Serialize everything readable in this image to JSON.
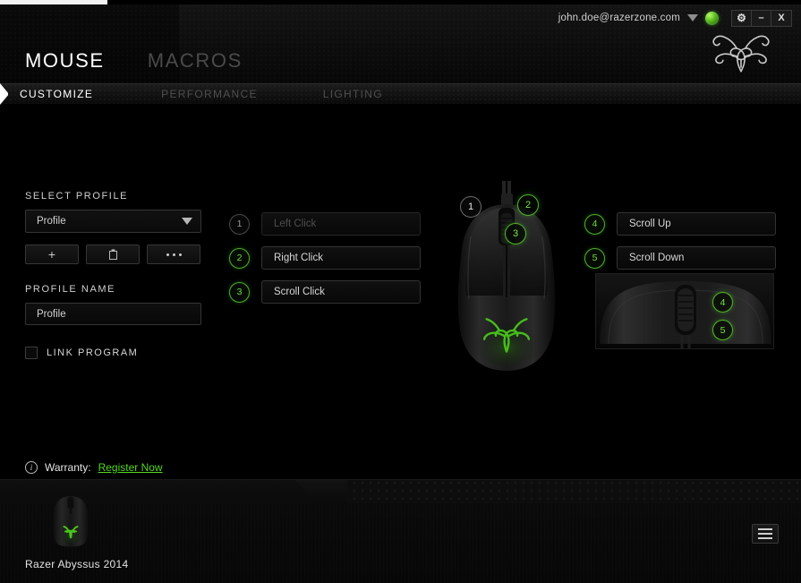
{
  "titlebar": {
    "user_email": "john.doe@razerzone.com",
    "dropdown_icon": "caret-down-icon",
    "status_icon": "green-status-orb",
    "buttons": [
      {
        "name": "settings",
        "icon": "gear-icon",
        "glyph": "⚙"
      },
      {
        "name": "minimize",
        "icon": "minimize-icon",
        "glyph": "–"
      },
      {
        "name": "close",
        "icon": "close-icon",
        "glyph": "X"
      }
    ]
  },
  "header": {
    "device_tabs": [
      {
        "label": "MOUSE",
        "active": true
      },
      {
        "label": "MACROS",
        "active": false
      }
    ],
    "logo_icon": "razer-triple-snake-logo"
  },
  "subtabs": [
    {
      "label": "CUSTOMIZE",
      "active": true
    },
    {
      "label": "PERFORMANCE",
      "active": false
    },
    {
      "label": "LIGHTING",
      "active": false
    }
  ],
  "profile": {
    "select_label": "SELECT PROFILE",
    "selected_profile": "Profile",
    "buttons": [
      {
        "name": "add-profile",
        "icon": "plus-icon",
        "glyph": "+"
      },
      {
        "name": "delete-profile",
        "icon": "trash-icon",
        "glyph": ""
      },
      {
        "name": "more-options",
        "icon": "ellipsis-icon",
        "glyph": ""
      }
    ],
    "name_label": "PROFILE NAME",
    "name_value": "Profile",
    "name_placeholder": "Profile",
    "link_program_label": "LINK PROGRAM",
    "link_program_checked": false
  },
  "assignments_left": [
    {
      "number": "1",
      "label": "Left Click",
      "state": "disabled"
    },
    {
      "number": "2",
      "label": "Right Click",
      "state": "active"
    },
    {
      "number": "3",
      "label": "Scroll Click",
      "state": "active"
    }
  ],
  "assignments_right": [
    {
      "number": "4",
      "label": "Scroll Up",
      "state": "active"
    },
    {
      "number": "5",
      "label": "Scroll Down",
      "state": "active"
    }
  ],
  "mouse_badges": [
    {
      "number": "1",
      "state": "disabled"
    },
    {
      "number": "2",
      "state": "active"
    },
    {
      "number": "3",
      "state": "active"
    }
  ],
  "sideview_badges": [
    {
      "number": "4",
      "state": "active"
    },
    {
      "number": "5",
      "state": "active"
    }
  ],
  "warranty": {
    "info_icon": "info-icon",
    "info_glyph": "i",
    "label": "Warranty:",
    "link_label": "Register Now"
  },
  "footer": {
    "device_name": "Razer Abyssus 2014",
    "device_thumb_icon": "mouse-thumbnail-icon",
    "menu_icon": "hamburger-menu-icon"
  },
  "colors": {
    "razer_green": "#53d61e",
    "badge_green": "#6ede3c",
    "text_primary": "#e2e2e2",
    "text_dim": "#4d4d4d",
    "background": "#000000"
  }
}
